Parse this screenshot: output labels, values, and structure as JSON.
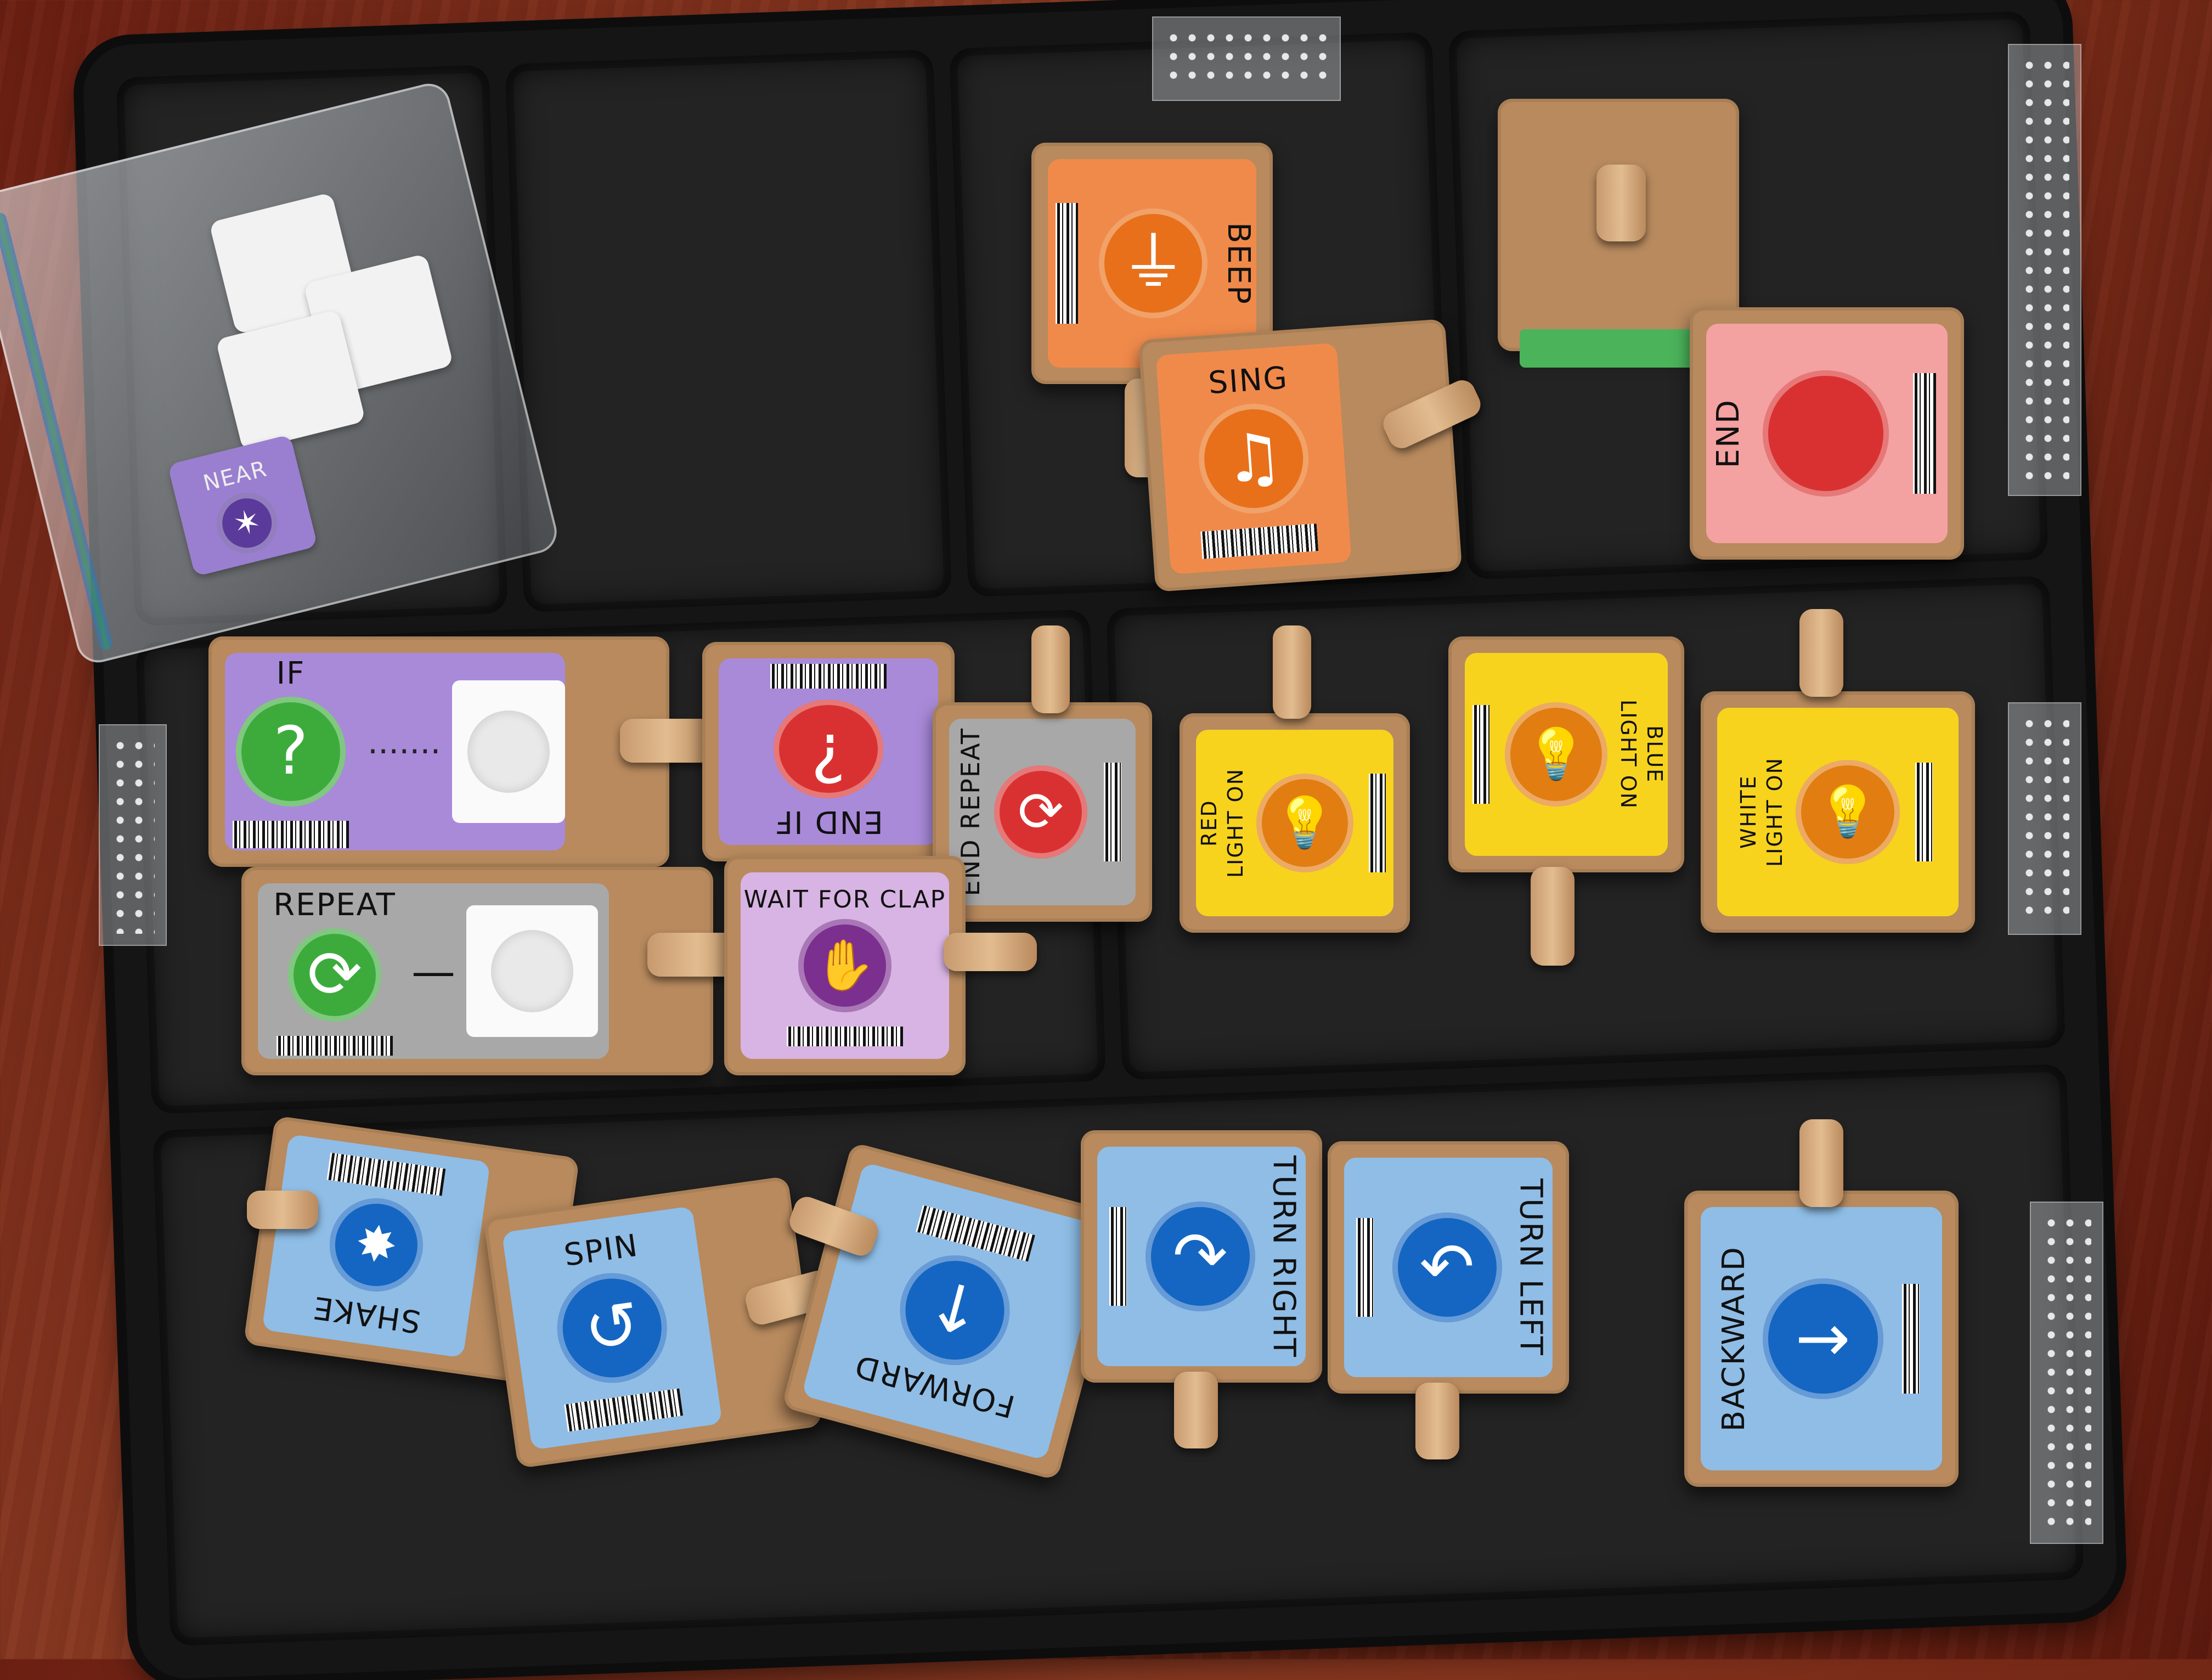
{
  "blocks": {
    "beep": {
      "label": "BEEP",
      "color": "#f08a4b",
      "icon": "bell-icon"
    },
    "sing": {
      "label": "SING",
      "color": "#f08a4b",
      "icon": "music-note-icon"
    },
    "end": {
      "label": "END",
      "color": "#f4a1a1",
      "icon": "stop-icon"
    },
    "if": {
      "label": "IF",
      "color": "#a98ad9",
      "icon": "question-icon"
    },
    "end_if": {
      "label": "END IF",
      "color": "#a98ad9",
      "icon": "inverted-question-icon"
    },
    "end_repeat": {
      "label": "END REPEAT",
      "color": "#a8a8a8",
      "icon": "repeat-icon"
    },
    "repeat": {
      "label": "REPEAT",
      "color": "#a8a8a8",
      "icon": "repeat-icon"
    },
    "wait_for_clap": {
      "label": "WAIT FOR CLAP",
      "color": "#d8b4e4",
      "icon": "clap-icon"
    },
    "red_light_on": {
      "label_line1": "RED",
      "label_line2": "LIGHT ON",
      "color": "#f7d31e",
      "icon": "lightbulb-icon"
    },
    "blue_light_on": {
      "label_line1": "BLUE",
      "label_line2": "LIGHT ON",
      "color": "#f7d31e",
      "icon": "lightbulb-icon"
    },
    "white_light_on": {
      "label_line1": "WHITE",
      "label_line2": "LIGHT ON",
      "color": "#f7d31e",
      "icon": "lightbulb-icon"
    },
    "shake": {
      "label": "SHAKE",
      "color": "#8fbde6",
      "icon": "shake-icon"
    },
    "spin": {
      "label": "SPIN",
      "color": "#8fbde6",
      "icon": "spin-icon"
    },
    "forward": {
      "label": "FORWARD",
      "color": "#8fbde6",
      "icon": "arrow-icon"
    },
    "turn_right": {
      "label": "TURN RIGHT",
      "color": "#8fbde6",
      "icon": "turn-right-icon"
    },
    "turn_left": {
      "label": "TURN LEFT",
      "color": "#8fbde6",
      "icon": "turn-left-icon"
    },
    "backward": {
      "label": "BACKWARD",
      "color": "#8fbde6",
      "icon": "arrow-icon"
    }
  },
  "bag_card": {
    "label": "NEAR",
    "color": "#9a7fd0"
  },
  "glyphs": {
    "bell": "⏚",
    "music": "♫",
    "question": "?",
    "inverted_question": "¿",
    "repeat": "⟳",
    "clap": "✋",
    "bulb": "💡",
    "shake": "✸",
    "spin": "↺",
    "arrow_down": "↓",
    "turn_right": "↷",
    "turn_left": "↶",
    "arrow_right": "→",
    "dash": "—",
    "dotted": "·······"
  },
  "colors": {
    "green_circle": "#3cab3c",
    "red_circle": "#d93131",
    "orange_circle": "#e8701a",
    "purple_circle": "#7b2f8f",
    "blue_circle": "#1466c2",
    "bulb_circle": "#e27d12"
  }
}
